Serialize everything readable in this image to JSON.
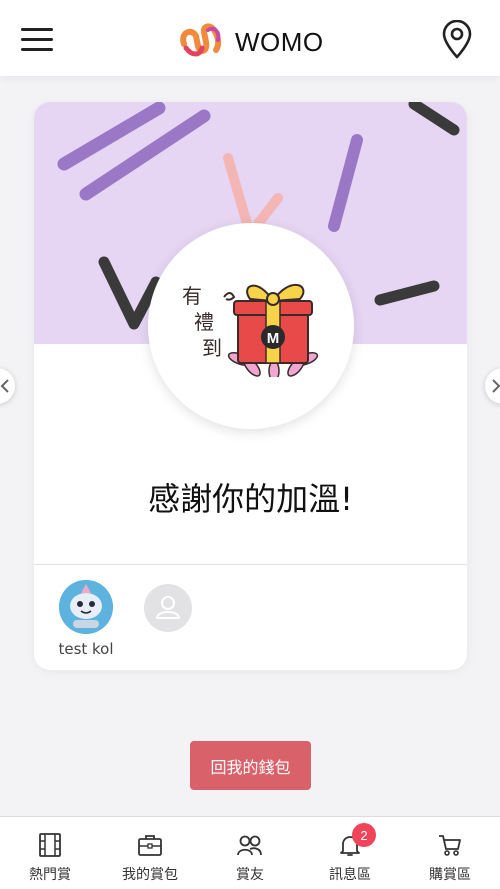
{
  "header": {
    "brand": "WOMO",
    "icons": {
      "menu": "menu-icon",
      "logo": "womo-logo",
      "location": "location-pin-icon"
    }
  },
  "card": {
    "gift_caption": "有禮到",
    "gift_badge": "M",
    "thanks_message": "感謝你的加溫!",
    "supporter": {
      "name": "test kol"
    },
    "colors": {
      "banner": "#e6d6f4",
      "deco_purple": "#9b78c6",
      "deco_dark": "#3a3a3a",
      "deco_pink": "#f4b6b4"
    }
  },
  "actions": {
    "back_to_wallet": "回我的錢包",
    "button_color": "#d9626a"
  },
  "bottom_nav": {
    "items": [
      {
        "label": "熱門賞",
        "icon": "film-icon"
      },
      {
        "label": "我的賞包",
        "icon": "briefcase-icon"
      },
      {
        "label": "賞友",
        "icon": "friends-icon"
      },
      {
        "label": "訊息區",
        "icon": "bell-icon",
        "badge": "2"
      },
      {
        "label": "購賞區",
        "icon": "cart-icon"
      }
    ]
  }
}
